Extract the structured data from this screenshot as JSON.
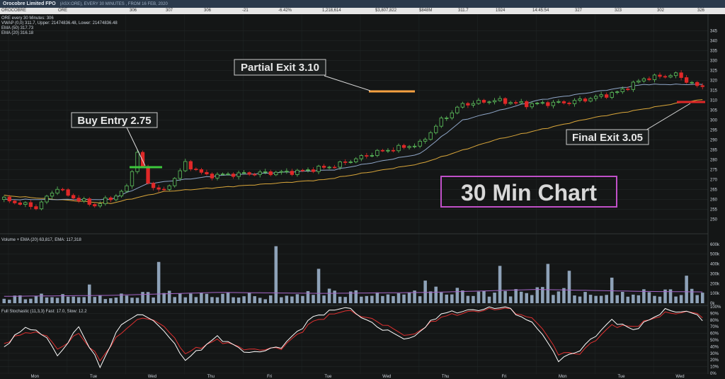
{
  "header": {
    "title": "Orocobre Limited FPO",
    "subtitle": "(ASX:ORE), EVERY 30 MINUTES , FROM 16 FEB, 2020"
  },
  "quote": {
    "name": "OROCOBRE",
    "symbol": "ORE",
    "cells": [
      "306",
      "307",
      "306",
      "-21",
      "-6.42%",
      "1,218,614",
      "$3,807,822",
      "$848M",
      "311.7",
      "1924",
      "14:45:54",
      "327",
      "323",
      "302",
      "326"
    ]
  },
  "legend": {
    "line1": "ORE every 30 Minutes: 306",
    "line2": "VWAP (0,0) 311.7, Upper: 21474836.48, Lower: 21474836.48",
    "line3": "EMA (50) 317.73",
    "line4": "EMA (20) 316.18"
  },
  "volume_legend": "Volume + EMA (20) 63,817, EMA: 117,318",
  "stoch_legend": "Full Stochastic (11,3,3) Fast: 17.0, Slow: 12.2",
  "annotations": {
    "buy": "Buy Entry 2.75",
    "partial": "Partial Exit 3.10",
    "final": "Final Exit 3.05",
    "chart_title": "30 Min Chart"
  },
  "colors": {
    "background": "#141616",
    "up_candle": "#5ec45e",
    "down_candle": "#e02828",
    "ema20": "#8fa6c8",
    "ema50": "#d9a63a",
    "volume": "#8ea2b8",
    "volume_ema": "#a565c8",
    "stoch_fast": "#ffffff",
    "stoch_slow": "#e03030",
    "buy_marker": "#3cc83c",
    "partial_marker": "#f5a040",
    "final_marker": "#e02828",
    "title_box": "#c050c8"
  },
  "chart_data": {
    "type": "candlestick",
    "x_axis_labels": [
      "Mon",
      "Tue",
      "Wed",
      "Thu",
      "Fri",
      "Tue",
      "Wed",
      "Thu",
      "Fri",
      "Mon",
      "Tue",
      "Wed"
    ],
    "price_ticks": [
      250,
      255,
      260,
      265,
      270,
      275,
      280,
      285,
      290,
      295,
      300,
      305,
      310,
      315,
      320,
      325,
      330,
      335,
      340,
      345
    ],
    "price_range": [
      247,
      347
    ],
    "volume_ticks": [
      "600k",
      "500k",
      "400k",
      "300k",
      "200k",
      "100k",
      "0k"
    ],
    "volume_range": [
      0,
      620
    ],
    "volume_unit": "k",
    "stoch_ticks": [
      "100%",
      "90%",
      "80%",
      "70%",
      "60%",
      "50%",
      "40%",
      "30%",
      "20%",
      "10%",
      "0%"
    ],
    "day_sessions": 12,
    "bars_per_session": 11,
    "close_keypoints": [
      [
        0,
        260
      ],
      [
        6,
        256
      ],
      [
        10,
        266
      ],
      [
        12,
        262
      ],
      [
        17,
        257
      ],
      [
        21,
        262
      ],
      [
        23,
        266
      ],
      [
        25,
        284
      ],
      [
        27,
        268
      ],
      [
        30,
        264
      ],
      [
        34,
        278
      ],
      [
        38,
        272
      ],
      [
        45,
        273
      ],
      [
        55,
        274
      ],
      [
        62,
        277
      ],
      [
        70,
        284
      ],
      [
        78,
        288
      ],
      [
        82,
        300
      ],
      [
        86,
        308
      ],
      [
        92,
        310
      ],
      [
        98,
        308
      ],
      [
        106,
        309
      ],
      [
        110,
        311
      ],
      [
        115,
        314
      ],
      [
        120,
        321
      ],
      [
        126,
        323
      ],
      [
        130,
        317
      ],
      [
        136,
        317
      ],
      [
        142,
        321
      ],
      [
        148,
        323
      ],
      [
        152,
        322
      ],
      [
        156,
        333
      ],
      [
        160,
        335
      ],
      [
        164,
        330
      ],
      [
        168,
        328
      ],
      [
        172,
        320
      ],
      [
        176,
        310
      ],
      [
        180,
        306
      ],
      [
        182,
        306
      ]
    ],
    "ema20_keypoints": [
      [
        0,
        260
      ],
      [
        20,
        260
      ],
      [
        27,
        268
      ],
      [
        40,
        272
      ],
      [
        62,
        275
      ],
      [
        78,
        283
      ],
      [
        86,
        300
      ],
      [
        100,
        310
      ],
      [
        120,
        318
      ],
      [
        140,
        318
      ],
      [
        152,
        322
      ],
      [
        160,
        330
      ],
      [
        168,
        327
      ],
      [
        176,
        320
      ],
      [
        182,
        312
      ]
    ],
    "ema50_keypoints": [
      [
        0,
        262
      ],
      [
        20,
        258
      ],
      [
        30,
        264
      ],
      [
        60,
        270
      ],
      [
        78,
        278
      ],
      [
        92,
        290
      ],
      [
        110,
        301
      ],
      [
        125,
        308
      ],
      [
        140,
        314
      ],
      [
        155,
        320
      ],
      [
        164,
        322
      ],
      [
        170,
        321
      ],
      [
        182,
        315
      ]
    ],
    "volume_keypoints": [
      [
        0,
        60
      ],
      [
        10,
        80
      ],
      [
        20,
        65
      ],
      [
        30,
        110
      ],
      [
        40,
        90
      ],
      [
        50,
        70
      ],
      [
        60,
        120
      ],
      [
        70,
        90
      ],
      [
        80,
        130
      ],
      [
        90,
        110
      ],
      [
        100,
        140
      ],
      [
        110,
        90
      ],
      [
        120,
        110
      ],
      [
        130,
        120
      ],
      [
        140,
        100
      ],
      [
        150,
        120
      ],
      [
        160,
        140
      ],
      [
        170,
        120
      ],
      [
        182,
        100
      ]
    ],
    "volume_spikes": [
      [
        16,
        190
      ],
      [
        29,
        420
      ],
      [
        51,
        580
      ],
      [
        59,
        350
      ],
      [
        79,
        230
      ],
      [
        93,
        380
      ],
      [
        102,
        400
      ],
      [
        106,
        330
      ],
      [
        114,
        260
      ],
      [
        128,
        280
      ],
      [
        146,
        200
      ],
      [
        157,
        350
      ]
    ],
    "volume_ema_keypoints": [
      [
        0,
        70
      ],
      [
        20,
        80
      ],
      [
        40,
        110
      ],
      [
        60,
        100
      ],
      [
        80,
        110
      ],
      [
        100,
        140
      ],
      [
        120,
        120
      ],
      [
        140,
        110
      ],
      [
        160,
        120
      ],
      [
        182,
        100
      ]
    ],
    "stoch_fast_keypoints": [
      [
        0,
        40
      ],
      [
        4,
        70
      ],
      [
        8,
        55
      ],
      [
        10,
        25
      ],
      [
        14,
        70
      ],
      [
        18,
        10
      ],
      [
        22,
        75
      ],
      [
        26,
        90
      ],
      [
        30,
        65
      ],
      [
        34,
        20
      ],
      [
        40,
        55
      ],
      [
        46,
        30
      ],
      [
        52,
        40
      ],
      [
        58,
        85
      ],
      [
        64,
        100
      ],
      [
        70,
        70
      ],
      [
        76,
        50
      ],
      [
        82,
        90
      ],
      [
        88,
        95
      ],
      [
        94,
        100
      ],
      [
        100,
        70
      ],
      [
        104,
        20
      ],
      [
        108,
        35
      ],
      [
        114,
        80
      ],
      [
        118,
        65
      ],
      [
        124,
        95
      ],
      [
        130,
        90
      ],
      [
        134,
        40
      ],
      [
        138,
        15
      ],
      [
        142,
        30
      ],
      [
        148,
        85
      ],
      [
        152,
        80
      ],
      [
        156,
        95
      ],
      [
        160,
        85
      ],
      [
        164,
        45
      ],
      [
        168,
        20
      ],
      [
        172,
        5
      ],
      [
        176,
        2
      ],
      [
        180,
        10
      ],
      [
        182,
        15
      ]
    ],
    "stoch_slow_keypoints": [
      [
        0,
        45
      ],
      [
        4,
        62
      ],
      [
        8,
        58
      ],
      [
        10,
        35
      ],
      [
        14,
        60
      ],
      [
        18,
        20
      ],
      [
        22,
        62
      ],
      [
        26,
        85
      ],
      [
        30,
        72
      ],
      [
        34,
        30
      ],
      [
        40,
        50
      ],
      [
        46,
        35
      ],
      [
        52,
        38
      ],
      [
        58,
        78
      ],
      [
        64,
        95
      ],
      [
        70,
        78
      ],
      [
        76,
        55
      ],
      [
        82,
        85
      ],
      [
        88,
        93
      ],
      [
        94,
        98
      ],
      [
        100,
        78
      ],
      [
        104,
        30
      ],
      [
        108,
        30
      ],
      [
        114,
        72
      ],
      [
        118,
        70
      ],
      [
        124,
        90
      ],
      [
        130,
        92
      ],
      [
        134,
        52
      ],
      [
        138,
        22
      ],
      [
        142,
        28
      ],
      [
        148,
        78
      ],
      [
        152,
        82
      ],
      [
        156,
        92
      ],
      [
        160,
        88
      ],
      [
        164,
        55
      ],
      [
        168,
        28
      ],
      [
        172,
        10
      ],
      [
        176,
        4
      ],
      [
        180,
        8
      ],
      [
        182,
        12
      ]
    ]
  }
}
